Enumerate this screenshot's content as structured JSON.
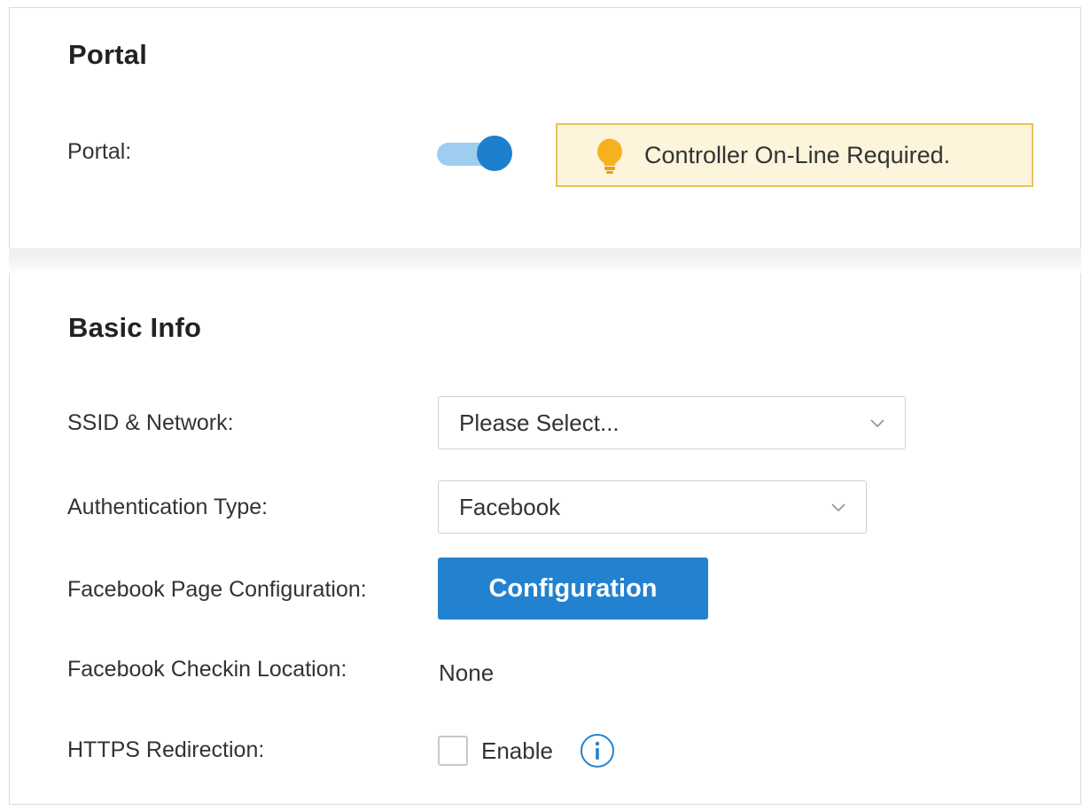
{
  "portal_section": {
    "title": "Portal",
    "portal_label": "Portal:",
    "portal_enabled": true,
    "notice_text": "Controller On-Line Required."
  },
  "basic_info": {
    "title": "Basic Info",
    "ssid_label": "SSID & Network:",
    "ssid_value": "Please Select...",
    "auth_label": "Authentication Type:",
    "auth_value": "Facebook",
    "fb_page_label": "Facebook Page Configuration:",
    "config_button_label": "Configuration",
    "fb_checkin_label": "Facebook Checkin Location:",
    "fb_checkin_value": "None",
    "https_label": "HTTPS Redirection:",
    "https_checkbox_label": "Enable",
    "https_enabled": false
  },
  "colors": {
    "accent": "#2382cf",
    "toggle_track": "#9fcdf0",
    "notice_bg": "#fdf4dc",
    "notice_border": "#e9c25b",
    "bulb": "#f5b21e"
  },
  "icons": {
    "notice": "lightbulb-icon",
    "dropdown": "chevron-down-icon",
    "info": "info-icon"
  }
}
